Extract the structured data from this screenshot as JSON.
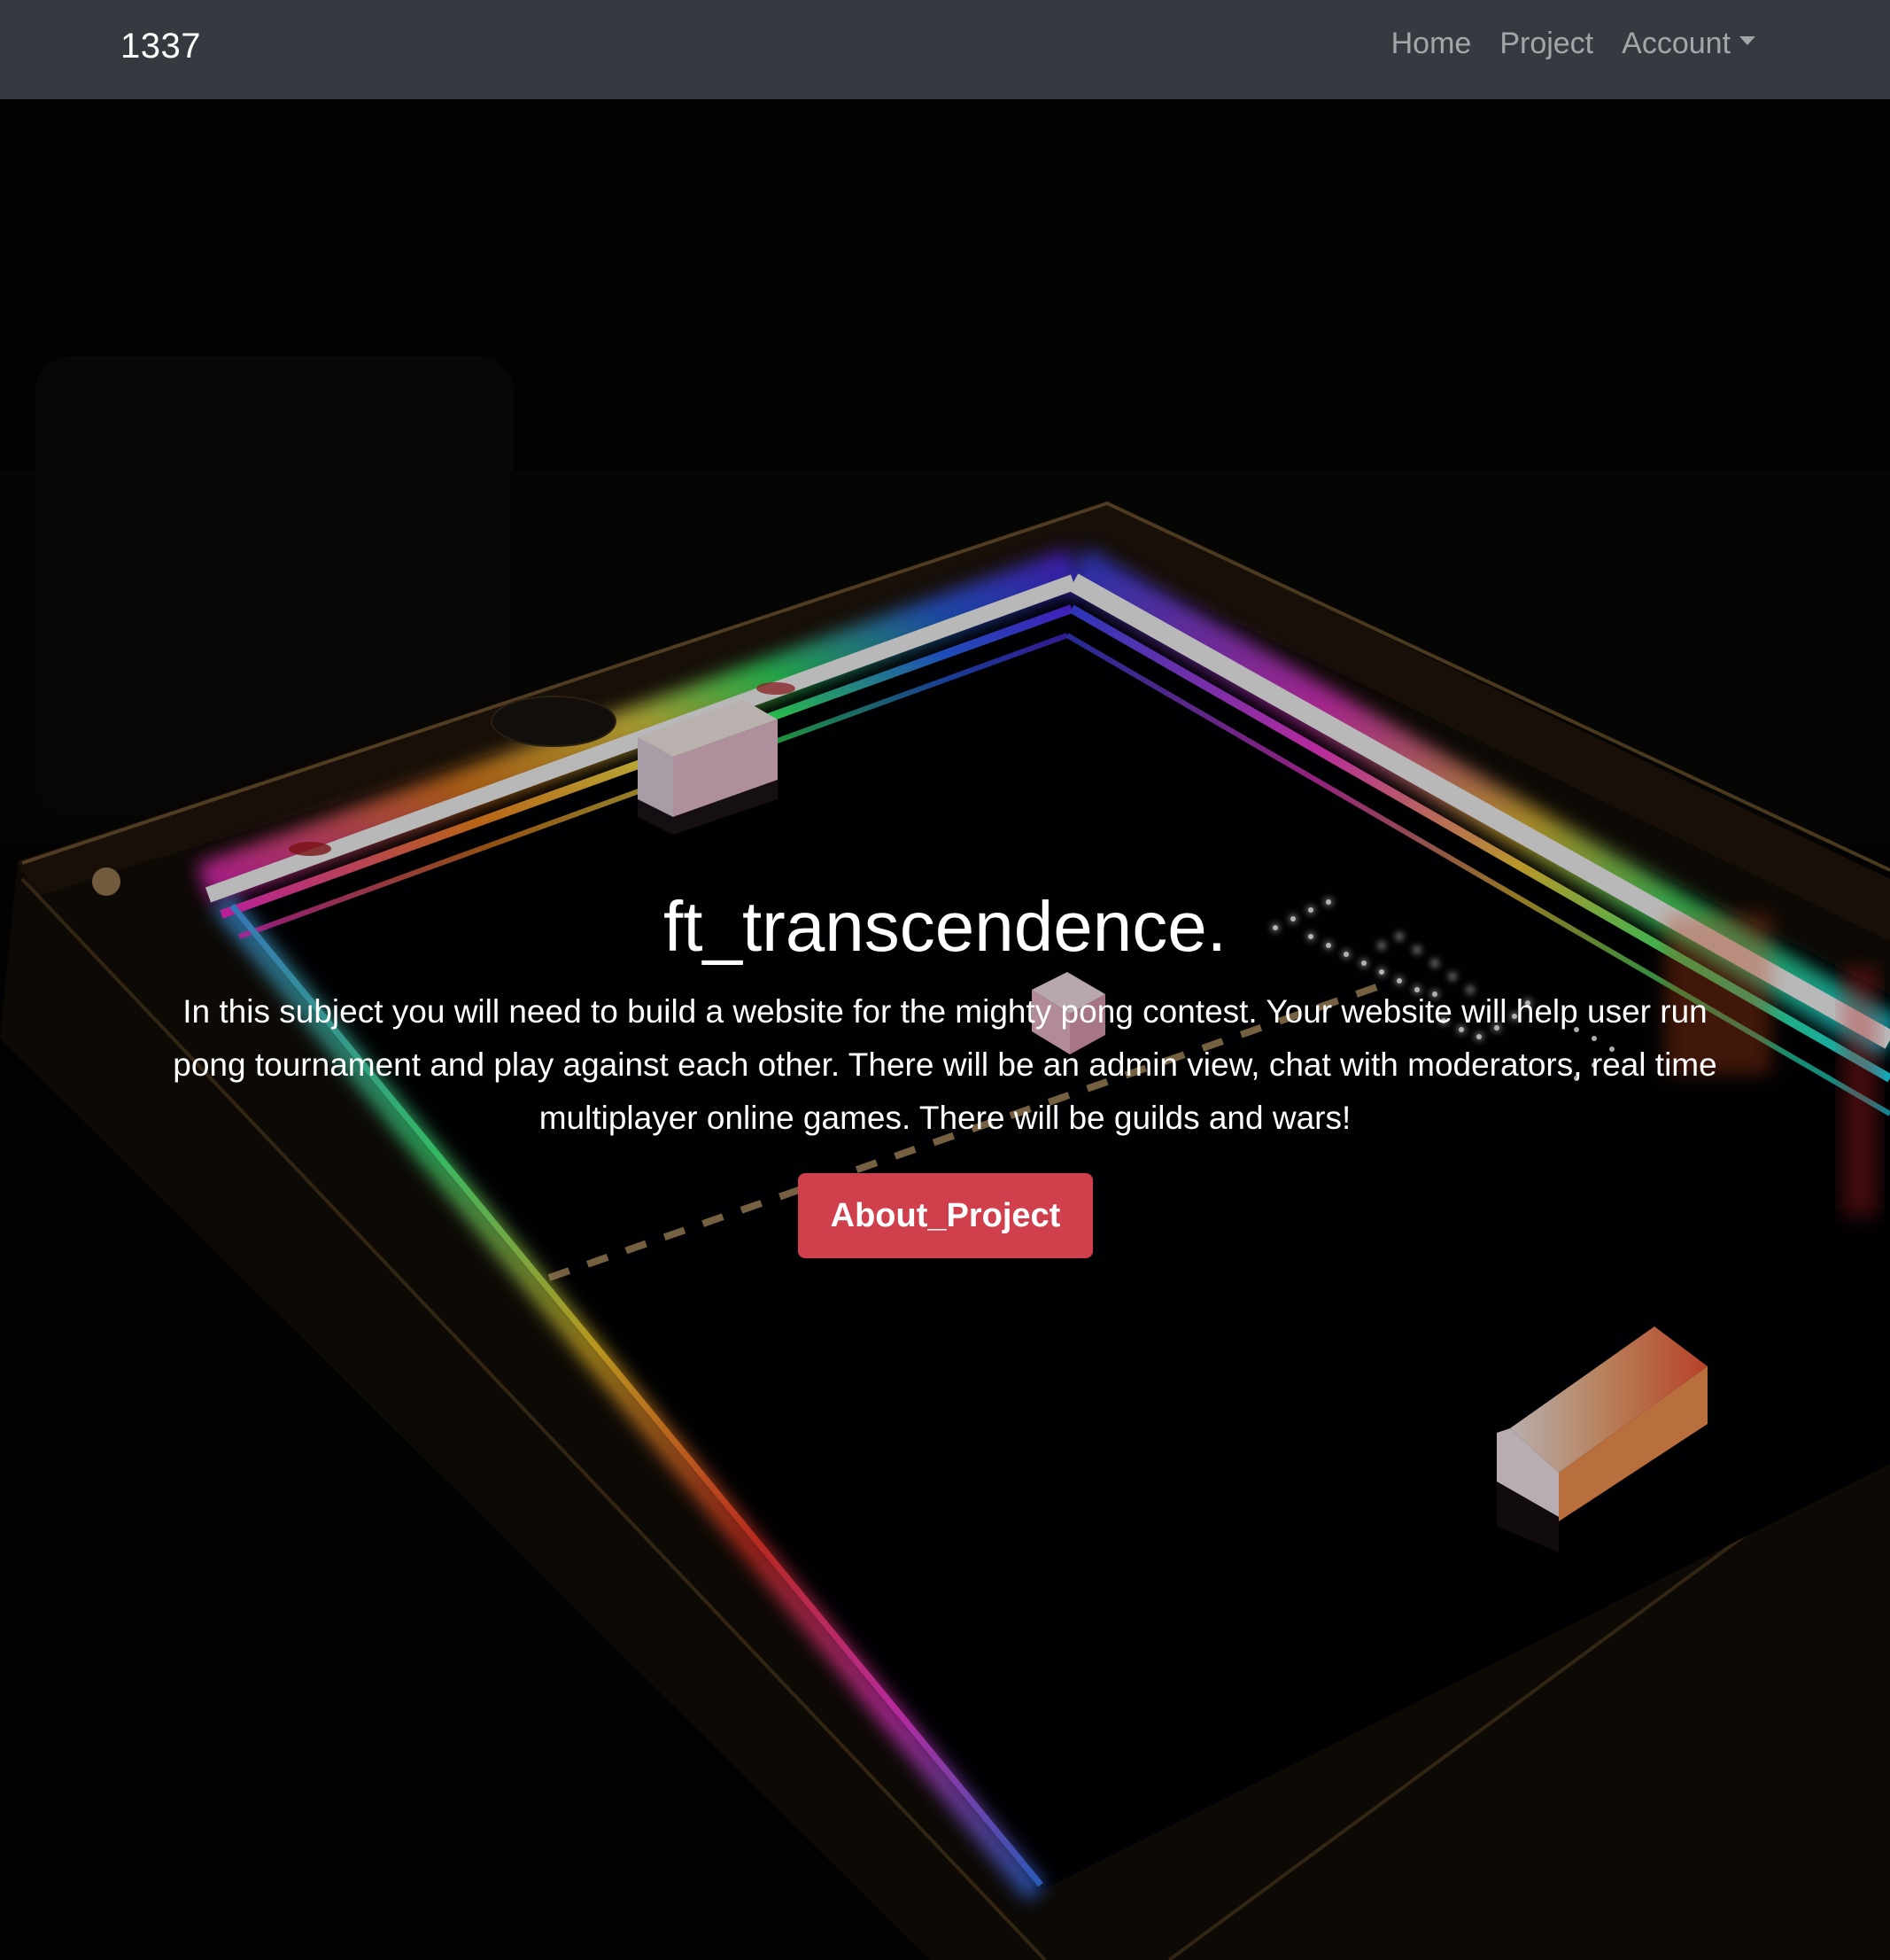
{
  "navbar": {
    "brand": "1337",
    "links": [
      {
        "label": "Home"
      },
      {
        "label": "Project"
      },
      {
        "label": "Account"
      }
    ]
  },
  "hero": {
    "title": "ft_transcendence.",
    "description": "In this subject you will need to build a website for the mighty pong contest. Your website will help user run pong tournament and play against each other. There will be an admin view, chat with moderators, real time multiplayer online games. There will be guilds and wars!",
    "button_label": "About_Project",
    "background_image": "neon-pong-table-photo"
  },
  "colors": {
    "navbar_bg": "#343a40",
    "button_bg": "#d0404c",
    "text": "#ffffff"
  }
}
